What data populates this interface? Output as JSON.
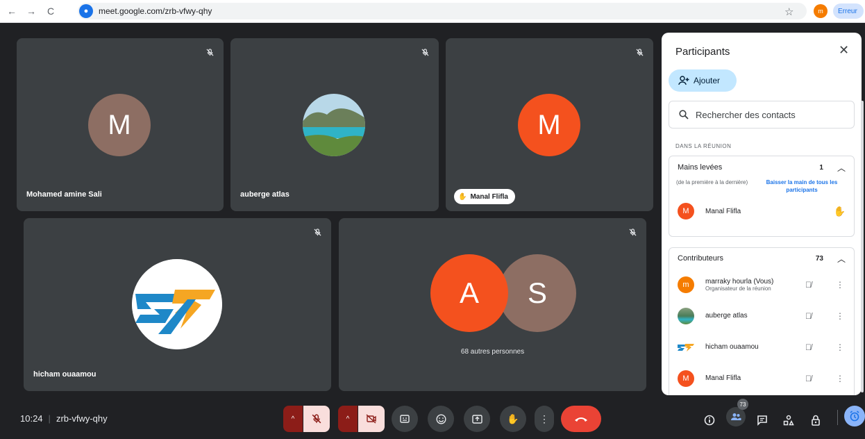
{
  "browser": {
    "url": "meet.google.com/zrb-vfwy-qhy",
    "profile_initial": "m",
    "error_chip": "Erreur",
    "back_icon": "←",
    "forward_icon": "→",
    "reload_icon": "C",
    "site_icon": "●",
    "star_icon": "☆"
  },
  "tiles": [
    {
      "name": "Mohamed amine Sali",
      "initial": "M",
      "avatar_color": "#8d6e63",
      "muted": true
    },
    {
      "name": "auberge atlas",
      "initial": "",
      "avatar_type": "photo",
      "muted": true
    },
    {
      "name": "Manal Flifla",
      "initial": "M",
      "avatar_color": "#f4511e",
      "muted": true,
      "hand_raised": true
    },
    {
      "name": "hicham ouaamou",
      "initial": "",
      "avatar_type": "logo",
      "muted": true
    },
    {
      "name": "",
      "others_text": "68 autres personnes",
      "initials": [
        "A",
        "S"
      ],
      "avatar_colors": [
        "#f4511e",
        "#8d6e63"
      ],
      "muted": true
    }
  ],
  "panel": {
    "title": "Participants",
    "close_icon": "✕",
    "add_label": "Ajouter",
    "search_placeholder": "Rechercher des contacts",
    "section_label": "DANS LA RÉUNION",
    "raised_hands": {
      "title": "Mains levées",
      "count": "1",
      "order_hint": "(de la première à la dernière)",
      "lower_all": "Baisser la main de tous les participants",
      "people": [
        {
          "name": "Manal Flifla",
          "initial": "M",
          "color": "#f4511e"
        }
      ]
    },
    "contributors": {
      "title": "Contributeurs",
      "count": "73",
      "people": [
        {
          "name": "marraky hourla (Vous)",
          "subtitle": "Organisateur de la réunion",
          "initial": "m",
          "color": "#f57c00"
        },
        {
          "name": "auberge atlas",
          "subtitle": "",
          "initial": "",
          "color": "#4a7c59"
        },
        {
          "name": "hicham ouaamou",
          "subtitle": "",
          "initial": "",
          "color": "#29b6f6"
        },
        {
          "name": "Manal Flifla",
          "subtitle": "",
          "initial": "M",
          "color": "#f4511e"
        }
      ]
    }
  },
  "bottom": {
    "time": "10:24",
    "separator": "|",
    "meeting_code": "zrb-vfwy-qhy",
    "people_badge": "73"
  },
  "colors": {
    "background": "#202124",
    "tile": "#3c4043",
    "hangup": "#ea4335",
    "muted_dark": "#8c1d18",
    "muted_light": "#f9dedc",
    "accent": "#1a73e8"
  }
}
